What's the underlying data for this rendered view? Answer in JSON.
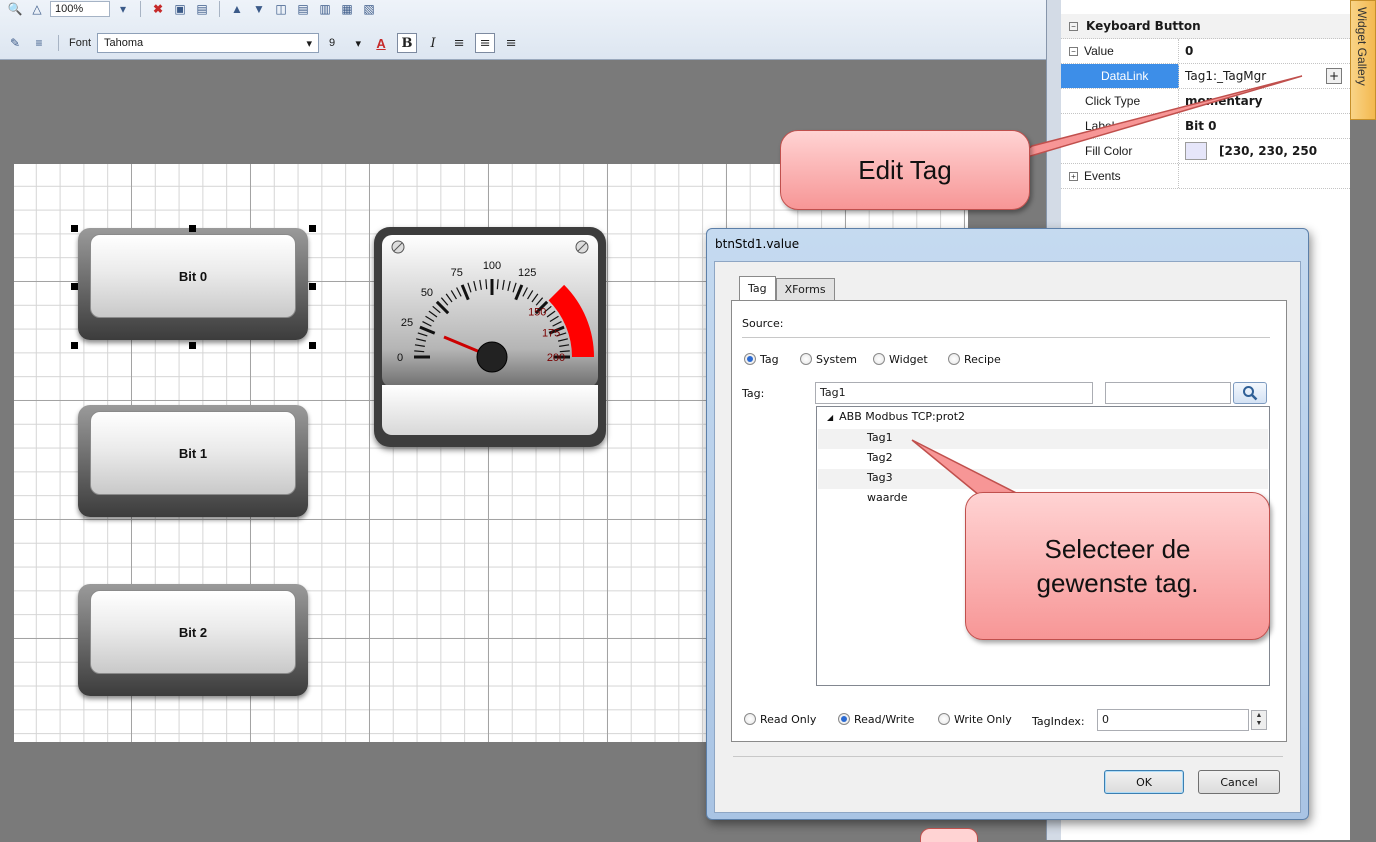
{
  "toolbar": {
    "zoom": "100%",
    "font_label": "Font",
    "font_name": "Tahoma",
    "font_size": "9",
    "bold": "B",
    "italic": "I"
  },
  "canvas": {
    "buttons": [
      {
        "label": "Bit 0"
      },
      {
        "label": "Bit 1"
      },
      {
        "label": "Bit 2"
      }
    ],
    "gauge": {
      "ticks": [
        "0",
        "25",
        "50",
        "75",
        "100",
        "125",
        "150",
        "175",
        "200"
      ],
      "accent": "#ff0000"
    }
  },
  "properties": {
    "section": "Keyboard Button",
    "rows": [
      {
        "name": "Value",
        "value": "0"
      },
      {
        "name": "DataLink",
        "value": "Tag1:_TagMgr"
      },
      {
        "name": "Click Type",
        "value": "momentary"
      },
      {
        "name": "Label",
        "value": "Bit 0"
      },
      {
        "name": "Fill Color",
        "value": "[230, 230, 250"
      },
      {
        "name": "Events",
        "value": ""
      }
    ],
    "datalink_button": "+",
    "fill_color": "#e6e6fa",
    "widget_gallery": "Widget Gallery"
  },
  "dialog": {
    "title": "btnStd1.value",
    "tabs": [
      "Tag",
      "XForms"
    ],
    "source_label": "Source:",
    "source_options": [
      "Tag",
      "System",
      "Widget",
      "Recipe"
    ],
    "source_selected": "Tag",
    "tag_label": "Tag:",
    "tag_value": "Tag1",
    "tree": {
      "root": "ABB Modbus TCP:prot2",
      "children": [
        "Tag1",
        "Tag2",
        "Tag3",
        "waarde"
      ],
      "selected": "Tag1"
    },
    "access_options": [
      "Read Only",
      "Read/Write",
      "Write Only"
    ],
    "access_selected": "Read/Write",
    "tagindex_label": "TagIndex:",
    "tagindex_value": "0",
    "ok": "OK",
    "cancel": "Cancel"
  },
  "callouts": {
    "edit_tag": "Edit Tag",
    "select_tag_line1": "Selecteer de",
    "select_tag_line2": "gewenste tag."
  },
  "colors": {
    "callout_fill": "#f79696",
    "callout_border": "#c0504d",
    "canvas_bg": "#7a7a7a",
    "gallery_tab": "#f3b84e"
  }
}
